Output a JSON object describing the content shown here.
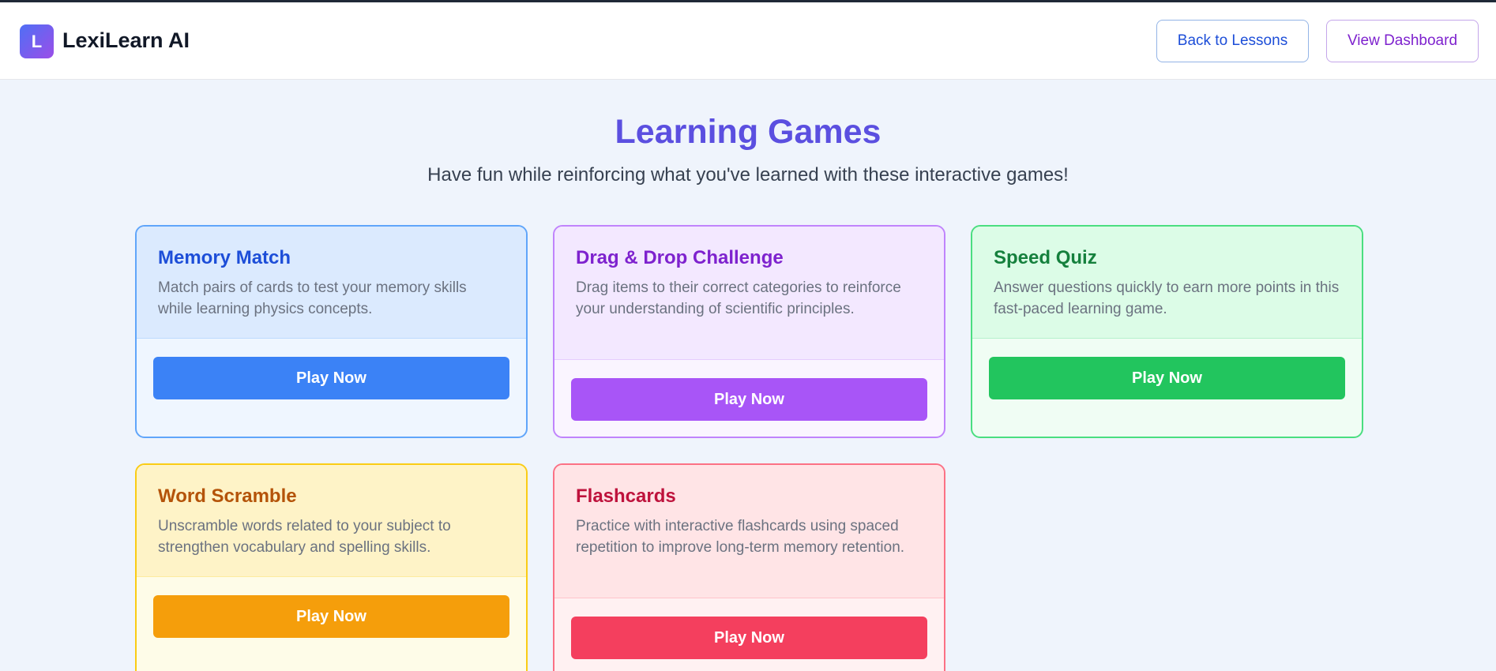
{
  "header": {
    "logo_letter": "L",
    "app_name": "LexiLearn AI",
    "back_label": "Back to Lessons",
    "dashboard_label": "View Dashboard"
  },
  "main": {
    "title": "Learning Games",
    "subtitle": "Have fun while reinforcing what you've learned with these interactive games!"
  },
  "games": [
    {
      "title": "Memory Match",
      "description": "Match pairs of cards to test your memory skills while learning physics concepts.",
      "button": "Play Now",
      "colors": {
        "border": "#60a5fa",
        "top_bg": "#dbeafe",
        "bottom_bg": "#eff6ff",
        "title": "#1d4ed8",
        "button": "#3b82f6"
      }
    },
    {
      "title": "Drag & Drop Challenge",
      "description": "Drag items to their correct categories to reinforce your understanding of scientific principles.",
      "button": "Play Now",
      "colors": {
        "border": "#c084fc",
        "top_bg": "#f3e8ff",
        "bottom_bg": "#faf5ff",
        "title": "#7e22ce",
        "button": "#a855f7"
      }
    },
    {
      "title": "Speed Quiz",
      "description": "Answer questions quickly to earn more points in this fast-paced learning game.",
      "button": "Play Now",
      "colors": {
        "border": "#4ade80",
        "top_bg": "#dcfce7",
        "bottom_bg": "#f0fdf4",
        "title": "#15803d",
        "button": "#22c55e"
      }
    },
    {
      "title": "Word Scramble",
      "description": "Unscramble words related to your subject to strengthen vocabulary and spelling skills.",
      "button": "Play Now",
      "colors": {
        "border": "#facc15",
        "top_bg": "#fef3c7",
        "bottom_bg": "#fefce8",
        "title": "#b45309",
        "button": "#f59e0b"
      }
    },
    {
      "title": "Flashcards",
      "description": "Practice with interactive flashcards using spaced repetition to improve long-term memory retention.",
      "button": "Play Now",
      "colors": {
        "border": "#fb7185",
        "top_bg": "#ffe4e6",
        "bottom_bg": "#fff1f2",
        "title": "#be123c",
        "button": "#f43f5e"
      }
    }
  ]
}
